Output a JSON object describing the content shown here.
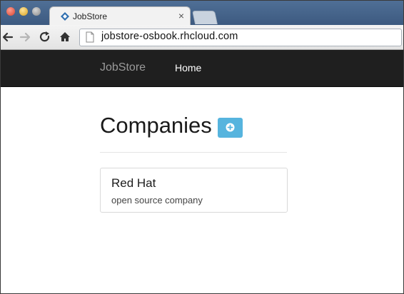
{
  "browser": {
    "tab": {
      "title": "JobStore",
      "favicon": "jobstore-diamond-icon",
      "close": "×"
    },
    "address_bar": {
      "url": "jobstore-osbook.rhcloud.com"
    },
    "toolbar_icons": [
      "back-arrow-icon",
      "forward-arrow-icon",
      "reload-icon",
      "home-icon",
      "page-icon"
    ]
  },
  "navbar": {
    "brand": "JobStore",
    "links": [
      {
        "label": "Home"
      }
    ]
  },
  "main": {
    "title": "Companies",
    "add_button_icon": "plus-circle-icon",
    "companies": [
      {
        "name": "Red Hat",
        "description": "open source company"
      }
    ]
  },
  "colors": {
    "navbar_bg": "#1f1f1f",
    "brand_text": "#9a9a9a",
    "add_button": "#56b4de",
    "card_border": "#d9d9d9"
  }
}
